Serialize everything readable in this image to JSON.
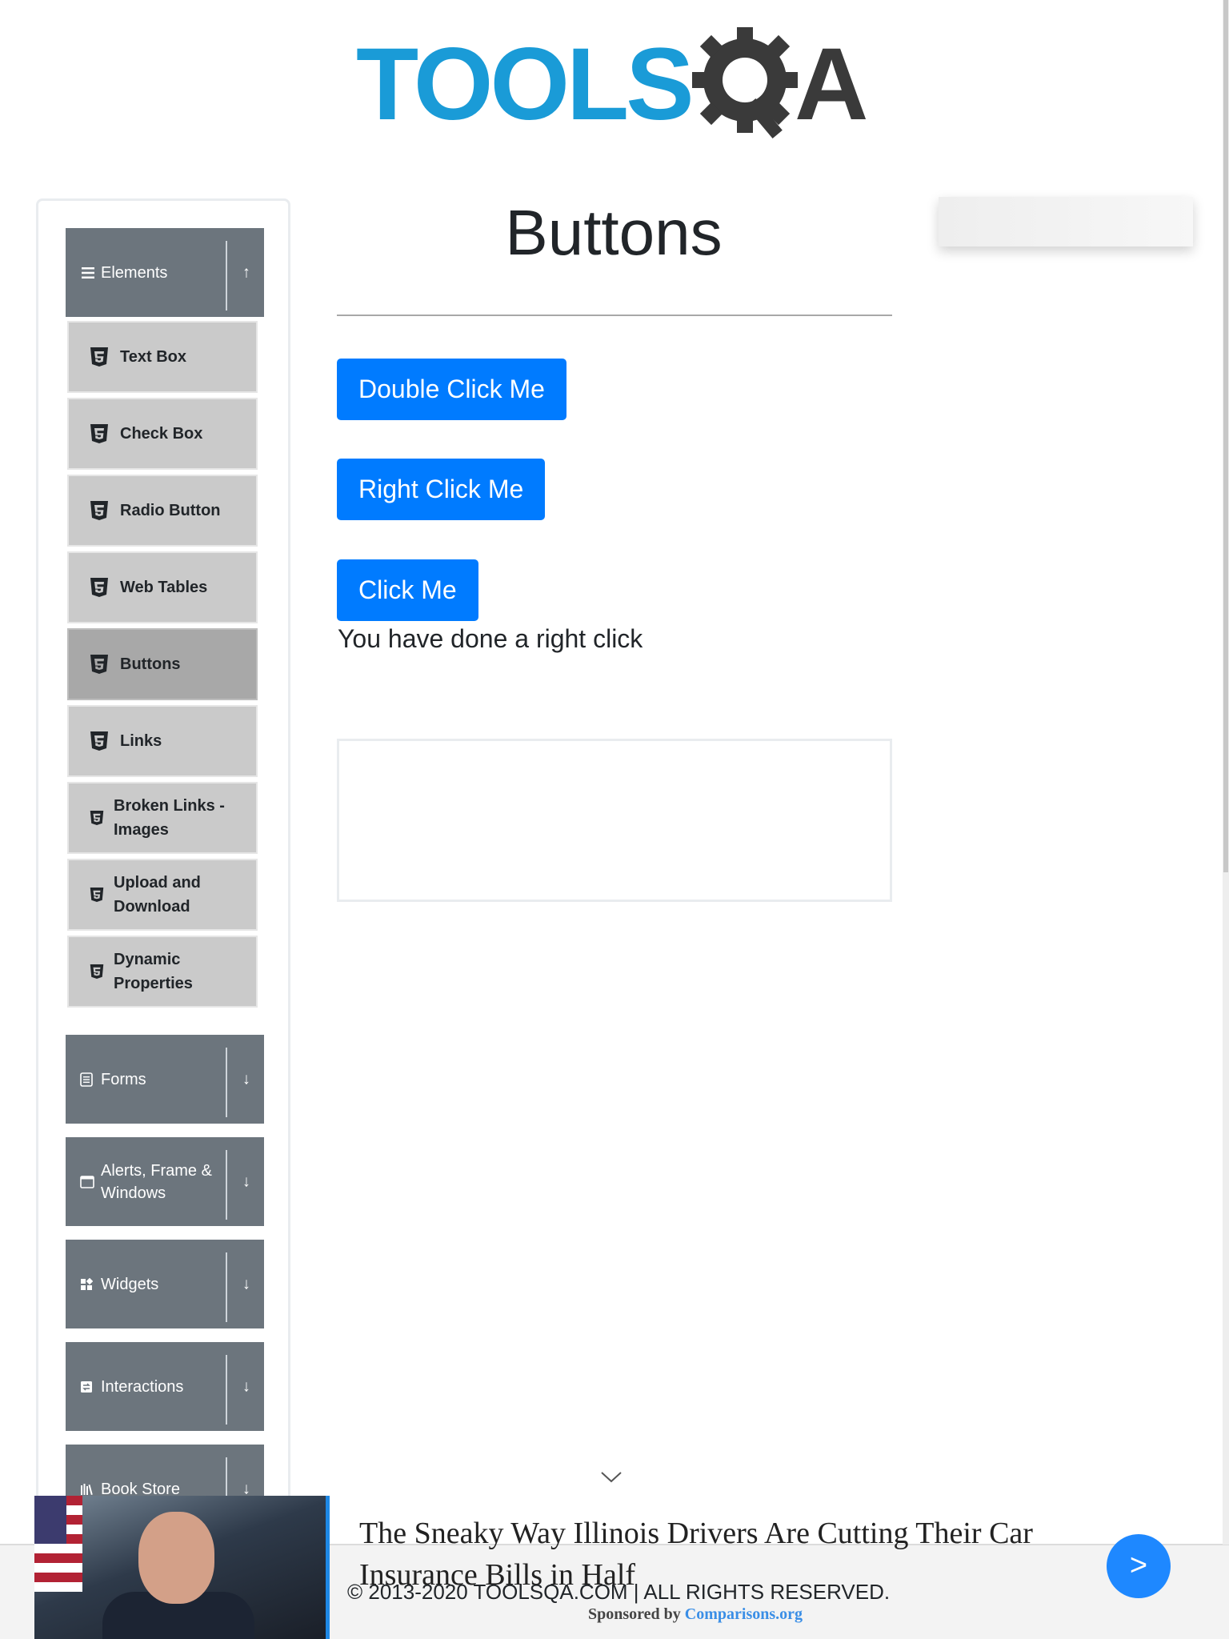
{
  "logo": {
    "text": "TOOLS",
    "a": "A",
    "alt": "TOOLSQA"
  },
  "sidebar": {
    "groups": [
      {
        "label": "Elements",
        "icon": "hamburger-icon",
        "expanded": true
      },
      {
        "label": "Forms",
        "icon": "document-icon",
        "expanded": false
      },
      {
        "label": "Alerts, Frame & Windows",
        "icon": "window-icon",
        "expanded": false
      },
      {
        "label": "Widgets",
        "icon": "widgets-icon",
        "expanded": false
      },
      {
        "label": "Interactions",
        "icon": "interactions-icon",
        "expanded": false
      },
      {
        "label": "Book Store",
        "icon": "books-icon",
        "expanded": false
      }
    ],
    "items": [
      {
        "label": "Text Box"
      },
      {
        "label": "Check Box"
      },
      {
        "label": "Radio Button"
      },
      {
        "label": "Web Tables"
      },
      {
        "label": "Buttons",
        "active": true
      },
      {
        "label": "Links"
      },
      {
        "label": "Broken Links - Images"
      },
      {
        "label": "Upload and Download"
      },
      {
        "label": "Dynamic Properties"
      }
    ],
    "expand_arrow": "↑",
    "collapse_arrow": "↓"
  },
  "main": {
    "title": "Buttons",
    "buttons": {
      "double_click": "Double Click Me",
      "right_click": "Right Click Me",
      "click": "Click Me"
    },
    "message": "You have done a right click"
  },
  "footer": {
    "text": "© 2013-2020 TOOLSQA.COM | ALL RIGHTS RESERVED."
  },
  "ad": {
    "headline": "The Sneaky Way Illinois Drivers Are Cutting Their Car Insurance Bills in Half",
    "sponsored_prefix": "Sponsored by",
    "sponsor": "Comparisons.org",
    "next": ">"
  },
  "colors": {
    "primary": "#007bff",
    "sidebar_group": "#6c757d",
    "sidebar_item": "#cacaca",
    "sidebar_item_active": "#a8a8a8",
    "logo_blue": "#1a9bd7"
  }
}
